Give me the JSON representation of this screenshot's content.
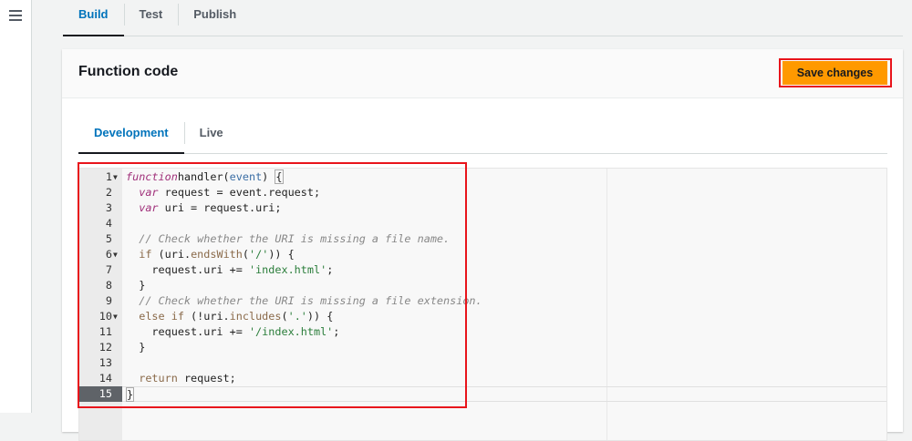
{
  "nav": {
    "tabs": [
      {
        "label": "Build",
        "active": true
      },
      {
        "label": "Test"
      },
      {
        "label": "Publish"
      }
    ]
  },
  "card": {
    "title": "Function code",
    "save_label": "Save changes"
  },
  "editor_tabs": [
    {
      "label": "Development",
      "active": true
    },
    {
      "label": "Live"
    }
  ],
  "editor": {
    "active_line": 15,
    "folds": [
      1,
      6,
      10
    ],
    "lines": [
      [
        [
          "kw",
          "function"
        ],
        [
          "",
          "handler("
        ],
        [
          "par",
          "event"
        ],
        [
          "",
          ") "
        ],
        [
          "br",
          "{"
        ]
      ],
      [
        [
          "",
          "  "
        ],
        [
          "kw",
          "var"
        ],
        [
          "",
          " request = event.request;"
        ]
      ],
      [
        [
          "",
          "  "
        ],
        [
          "kw",
          "var"
        ],
        [
          "",
          " uri = request.uri;"
        ]
      ],
      [],
      [
        [
          "",
          "  "
        ],
        [
          "cm",
          "// Check whether the URI is missing a file name."
        ]
      ],
      [
        [
          "",
          "  "
        ],
        [
          "ctl",
          "if"
        ],
        [
          "",
          " (uri."
        ],
        [
          "fn",
          "endsWith"
        ],
        [
          "",
          "("
        ],
        [
          "str",
          "'/'"
        ],
        [
          "",
          ")) {"
        ]
      ],
      [
        [
          "",
          "    request.uri += "
        ],
        [
          "str",
          "'index.html'"
        ],
        [
          "",
          ";"
        ]
      ],
      [
        [
          "",
          "  }"
        ]
      ],
      [
        [
          "",
          "  "
        ],
        [
          "cm",
          "// Check whether the URI is missing a file extension."
        ]
      ],
      [
        [
          "",
          "  "
        ],
        [
          "ctl",
          "else if"
        ],
        [
          "",
          " (!uri."
        ],
        [
          "fn",
          "includes"
        ],
        [
          "",
          "("
        ],
        [
          "str",
          "'.'"
        ],
        [
          "",
          ")) {"
        ]
      ],
      [
        [
          "",
          "    request.uri += "
        ],
        [
          "str",
          "'/index.html'"
        ],
        [
          "",
          ";"
        ]
      ],
      [
        [
          "",
          "  }"
        ]
      ],
      [],
      [
        [
          "",
          "  "
        ],
        [
          "ctl",
          "return"
        ],
        [
          "",
          " request;"
        ]
      ],
      [
        [
          "br",
          "}"
        ]
      ]
    ]
  },
  "colors": {
    "accent": "#0073bb",
    "button": "#ff9900",
    "highlight": "#e8141b"
  }
}
